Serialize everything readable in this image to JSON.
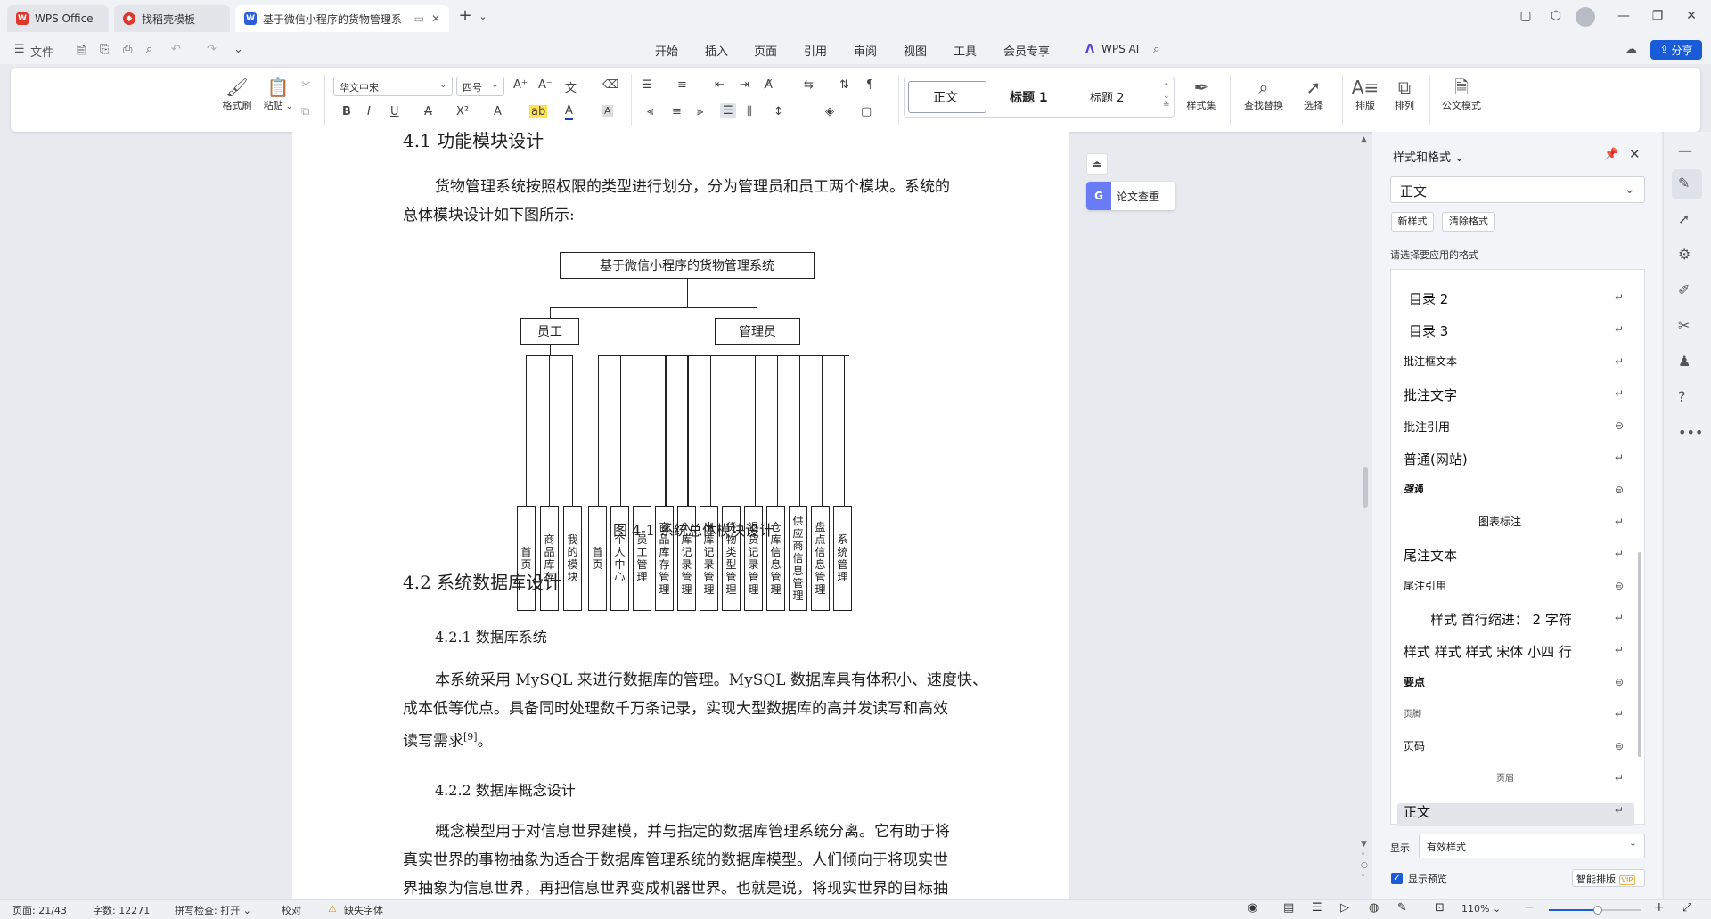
{
  "tabs": [
    {
      "label": "WPS Office",
      "icon": "wps-logo-icon"
    },
    {
      "label": "找稻壳模板",
      "icon": "docer-icon"
    },
    {
      "label": "基于微信小程序的货物管理系",
      "icon": "word-doc-icon"
    }
  ],
  "menu": {
    "file": "文件",
    "items": [
      "开始",
      "插入",
      "页面",
      "引用",
      "审阅",
      "视图",
      "工具",
      "会员专享"
    ],
    "active": "开始",
    "wps_ai": "WPS AI",
    "share": "分享"
  },
  "ribbon": {
    "format_painter": "格式刷",
    "paste": "粘贴",
    "font_name": "华文中宋",
    "font_size": "四号",
    "styles": [
      "正文",
      "标题 1",
      "标题 2"
    ],
    "style_set": "样式集",
    "find_replace": "查找替换",
    "select": "选择",
    "layout": "排版",
    "arrange": "排列",
    "formula_mode": "公文模式"
  },
  "doc": {
    "h_41": "4.1 功能模块设计",
    "p1": "货物管理系统按照权限的类型进行划分，分为管理员和员工两个模块。系统的",
    "p1b": "总体模块设计如下图所示:",
    "diagram": {
      "root": "基于微信小程序的货物管理系统",
      "employee": "员工",
      "admin": "管理员",
      "employee_modules": [
        "首页",
        "商品库存",
        "我的模块"
      ],
      "admin_modules": [
        "首页",
        "个人中心",
        "员工管理",
        "商品库存管理",
        "入库记录管理",
        "出库记录管理",
        "货物类型管理",
        "退货记录管理",
        "仓库信息管理",
        "供应商信息管理",
        "盘点信息管理",
        "系统管理"
      ]
    },
    "caption": "图 4-1  系统总体模块设计",
    "h_42": "4.2 系统数据库设计",
    "h_421": "4.2.1 数据库系统",
    "p2a": "本系统采用 MySQL 来进行数据库的管理。MySQL 数据库具有体积小、速度快、",
    "p2b": "成本低等优点。具备同时处理数千万条记录，实现大型数据库的高并发读写和高效",
    "p2c": "读写需求",
    "p2c_sup": "[9]",
    "p2c_end": "。",
    "h_422": "4.2.2 数据库概念设计",
    "p3a": "概念模型用于对信息世界建模，并与指定的数据库管理系统分离。它有助于将",
    "p3b": "真实世界的事物抽象为适合于数据库管理系统的数据库模型。人们倾向于将现实世",
    "p3c": "界抽象为信息世界，再把信息世界变成机器世界。也就是说，将现实世界的目标抽"
  },
  "float": {
    "plagiarism": "论文查重"
  },
  "panel": {
    "title": "样式和格式",
    "current": "正文",
    "new_style": "新样式",
    "clear_format": "清除格式",
    "hint": "请选择要应用的格式",
    "styles": [
      "目录 2",
      "目录 3",
      "批注框文本",
      "批注文字",
      "批注引用",
      "普通(网站)",
      "强调",
      "图表标注",
      "尾注文本",
      "尾注引用",
      "样式 首行缩进： 2 字符",
      "样式 样式 样式 宋体 小四 行",
      "要点",
      "页脚",
      "页码",
      "页眉",
      "正文"
    ],
    "show_label": "显示",
    "show_value": "有效样式",
    "preview": "显示预览",
    "smart_layout": "智能排版",
    "vip": "VIP"
  },
  "status": {
    "page": "页面: 21/43",
    "words": "字数: 12271",
    "spell": "拼写检查: 打开",
    "proof": "校对",
    "missing_font": "缺失字体",
    "zoom": "110%"
  },
  "colors": {
    "accent": "#1a5bd7",
    "wps_red": "#e0352b"
  }
}
